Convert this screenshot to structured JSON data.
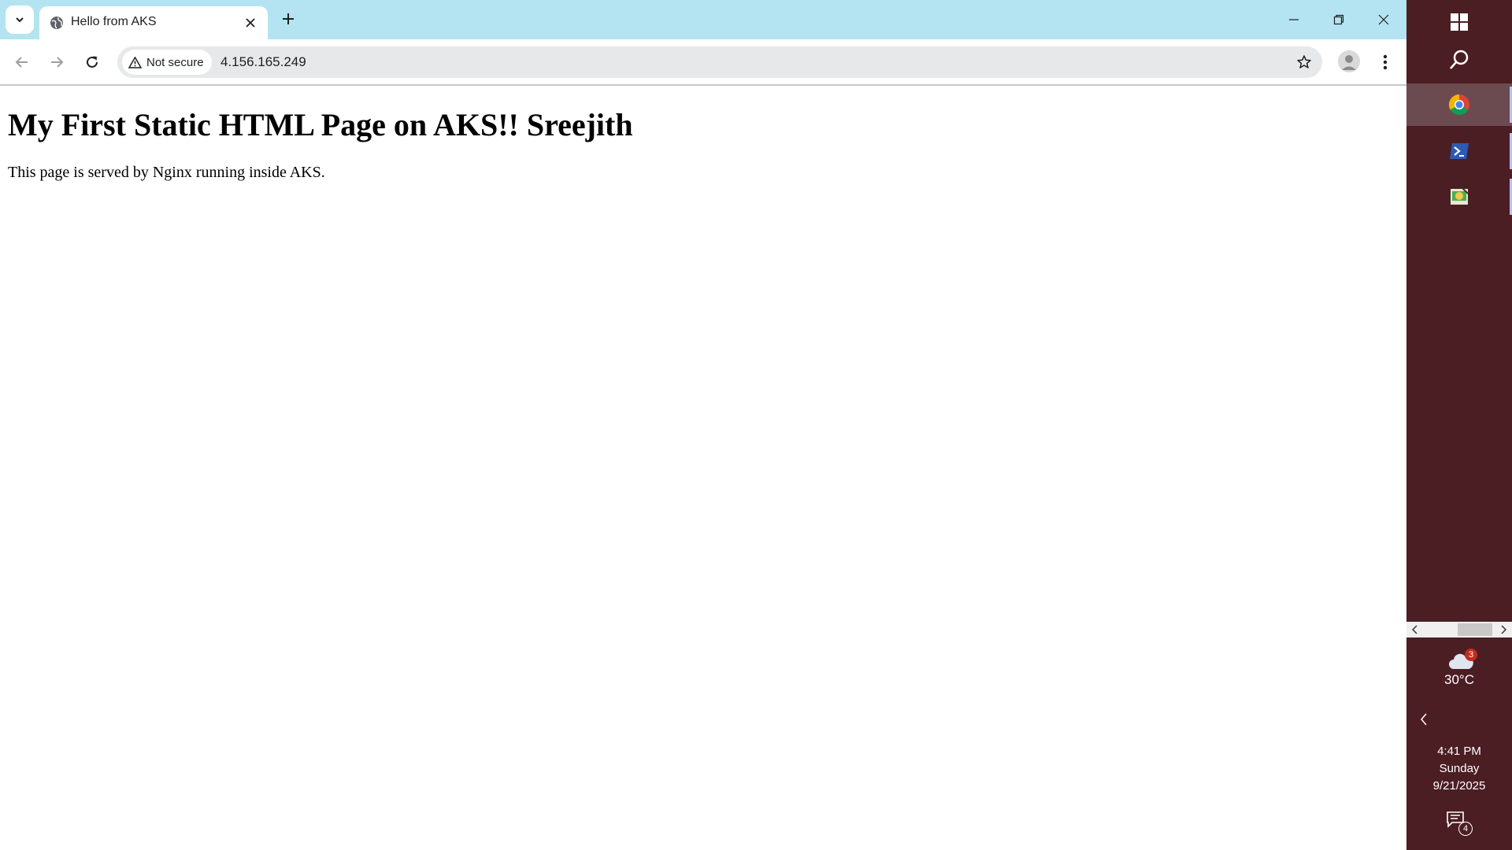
{
  "browser": {
    "tab": {
      "title": "Hello from AKS"
    },
    "toolbar": {
      "security_label": "Not secure",
      "url": "4.156.165.249"
    }
  },
  "page": {
    "heading": "My First Static HTML Page on AKS!! Sreejith",
    "paragraph": "This page is served by Nginx running inside AKS."
  },
  "taskbar": {
    "apps": [
      "windows-start",
      "search",
      "chrome",
      "powershell",
      "app"
    ],
    "weather": {
      "temperature": "30°C",
      "badge": "3"
    },
    "clock": {
      "time": "4:41 PM",
      "day": "Sunday",
      "date": "9/21/2025"
    },
    "notifications": {
      "count": "4"
    }
  },
  "colors": {
    "tabstrip": "#b4e4f1",
    "taskbar": "#4b1e24",
    "omnibox": "#e6e8ea"
  }
}
